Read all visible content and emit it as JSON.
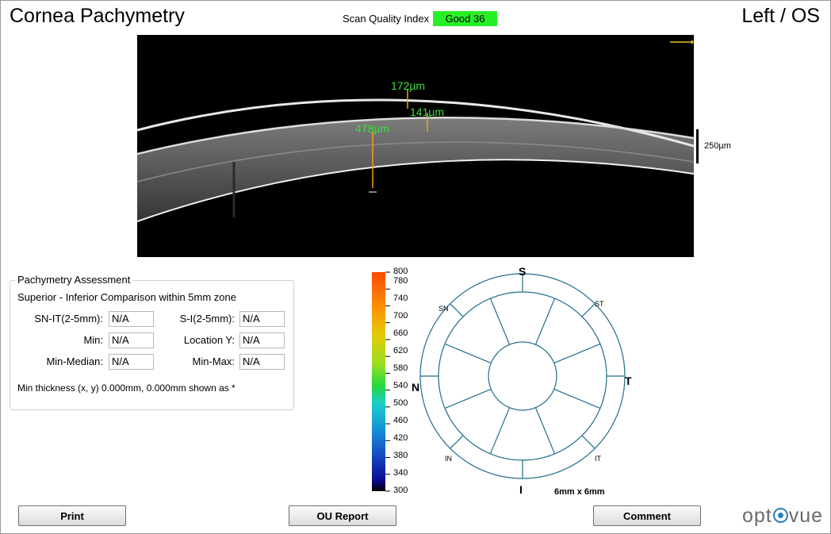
{
  "header": {
    "title": "Cornea Pachymetry",
    "eye": "Left / OS",
    "scan_quality_label": "Scan Quality Index",
    "scan_quality_value": "Good  36",
    "scan_quality_color": "#26ef26"
  },
  "scan_image": {
    "scale_label": "250µm",
    "measurements": [
      {
        "label": "172µm"
      },
      {
        "label": "141µm"
      },
      {
        "label": "478µm"
      }
    ],
    "measurement_color": "#38e038",
    "caliper_color": "#f0a020"
  },
  "assessment": {
    "title": "Pachymetry Assessment",
    "subtitle": "Superior - Inferior Comparison within 5mm zone",
    "fields": [
      {
        "label": "SN-IT(2-5mm):",
        "value": "N/A"
      },
      {
        "label": "S-I(2-5mm):",
        "value": "N/A"
      },
      {
        "label": "Min:",
        "value": "N/A"
      },
      {
        "label": "Location Y:",
        "value": "N/A"
      },
      {
        "label": "Min-Median:",
        "value": "N/A"
      },
      {
        "label": "Min-Max:",
        "value": "N/A"
      }
    ],
    "note": "Min thickness (x, y) 0.000mm, 0.000mm shown as *"
  },
  "colorbar": {
    "labels": [
      "800",
      "780",
      "740",
      "700",
      "660",
      "620",
      "580",
      "540",
      "500",
      "460",
      "420",
      "380",
      "340",
      "300"
    ]
  },
  "map": {
    "labels": {
      "S": "S",
      "I": "I",
      "N": "N",
      "T": "T",
      "SN": "SN",
      "ST": "ST",
      "IN": "IN",
      "IT": "IT"
    },
    "size_label": "6mm x 6mm",
    "line_color": "#1f6e8c"
  },
  "buttons": {
    "print": "Print",
    "ou_report": "OU Report",
    "comment": "Comment"
  },
  "logo": {
    "text_left": "opt",
    "text_right": "vue",
    "icon": "eye-dot-icon",
    "color": "#2b7fb8"
  }
}
